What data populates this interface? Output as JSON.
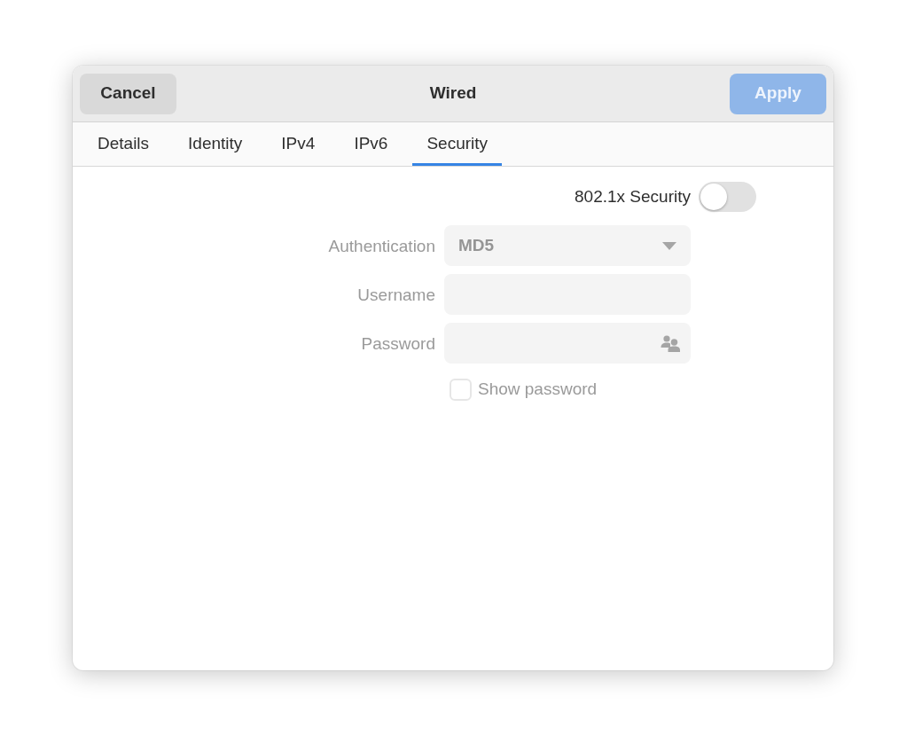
{
  "header": {
    "cancel_button": "Cancel",
    "title": "Wired",
    "apply_button": {
      "label": "Apply",
      "disabled": true
    }
  },
  "tabs": [
    {
      "label": "Details",
      "selected": false
    },
    {
      "label": "Identity",
      "selected": false
    },
    {
      "label": "IPv4",
      "selected": false
    },
    {
      "label": "IPv6",
      "selected": false
    },
    {
      "label": "Security",
      "selected": true
    }
  ],
  "security_toggle": {
    "label": "802.1x Security",
    "on": false
  },
  "form": {
    "disabled": true,
    "fields": [
      {
        "kind": "dropdown",
        "label": "Authentication",
        "value": "MD5"
      },
      {
        "kind": "text",
        "label": "Username"
      },
      {
        "kind": "password",
        "label": "Password"
      }
    ],
    "show_password": {
      "label": "Show password",
      "checked": false
    }
  }
}
